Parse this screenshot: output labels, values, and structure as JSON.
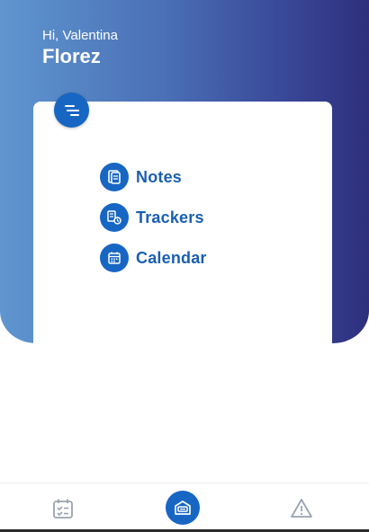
{
  "header": {
    "greeting": "Hi, Valentina",
    "name": "Florez"
  },
  "menu": {
    "toggle_icon": "menu-lines-icon",
    "items": [
      {
        "label": "Notes",
        "icon": "notes-icon"
      },
      {
        "label": "Trackers",
        "icon": "trackers-icon"
      },
      {
        "label": "Calendar",
        "icon": "calendar-icon"
      }
    ]
  },
  "bottom_nav": {
    "items": [
      {
        "icon": "calendar-check-icon",
        "active": false
      },
      {
        "icon": "home-box-icon",
        "active": true
      },
      {
        "icon": "warning-icon",
        "active": false
      }
    ]
  },
  "colors": {
    "accent": "#1766c4",
    "label": "#1a5fb4",
    "gradient_start": "#5f96cf",
    "gradient_end": "#2e2f7d",
    "inactive_icon": "#9aa3b2"
  }
}
